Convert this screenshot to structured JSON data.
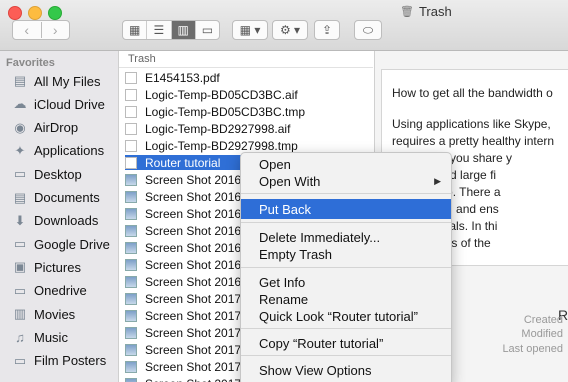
{
  "window": {
    "title": "Trash"
  },
  "toolbar": {
    "back": "‹",
    "forward": "›",
    "view_icons": [
      "icon-view-icon",
      "list-view-icon",
      "column-view-icon",
      "cover-flow-icon"
    ],
    "arrange_glyph": "▦ ▾",
    "action_glyph": "⚙ ▾",
    "share_glyph": "⇪",
    "tag_glyph": "⬭"
  },
  "sidebar": {
    "heading": "Favorites",
    "items": [
      {
        "label": "All My Files",
        "glyph": "▤"
      },
      {
        "label": "iCloud Drive",
        "glyph": "☁"
      },
      {
        "label": "AirDrop",
        "glyph": "◉"
      },
      {
        "label": "Applications",
        "glyph": "✦"
      },
      {
        "label": "Desktop",
        "glyph": "▭"
      },
      {
        "label": "Documents",
        "glyph": "▤"
      },
      {
        "label": "Downloads",
        "glyph": "⬇"
      },
      {
        "label": "Google Drive",
        "glyph": "▭"
      },
      {
        "label": "Pictures",
        "glyph": "▣"
      },
      {
        "label": "Onedrive",
        "glyph": "▭"
      },
      {
        "label": "Movies",
        "glyph": "▥"
      },
      {
        "label": "Music",
        "glyph": "♫"
      },
      {
        "label": "Film Posters",
        "glyph": "▭"
      }
    ]
  },
  "filelist": {
    "heading": "Trash",
    "rows": [
      {
        "name": "E1454153.pdf",
        "kind": "doc"
      },
      {
        "name": "Logic-Temp-BD05CD3BC.aif",
        "kind": "doc"
      },
      {
        "name": "Logic-Temp-BD05CD3BC.tmp",
        "kind": "doc"
      },
      {
        "name": "Logic-Temp-BD2927998.aif",
        "kind": "doc"
      },
      {
        "name": "Logic-Temp-BD2927998.tmp",
        "kind": "doc"
      },
      {
        "name": "Router tutorial",
        "kind": "doc",
        "selected": true
      },
      {
        "name": "Screen Shot 2016-",
        "kind": "img"
      },
      {
        "name": "Screen Shot 2016-",
        "kind": "img"
      },
      {
        "name": "Screen Shot 2016-",
        "kind": "img"
      },
      {
        "name": "Screen Shot 2016-",
        "kind": "img"
      },
      {
        "name": "Screen Shot 2016-",
        "kind": "img"
      },
      {
        "name": "Screen Shot 2016-",
        "kind": "img"
      },
      {
        "name": "Screen Shot 2016-",
        "kind": "img"
      },
      {
        "name": "Screen Shot 2017-",
        "kind": "img"
      },
      {
        "name": "Screen Shot 2017-",
        "kind": "img"
      },
      {
        "name": "Screen Shot 2017-",
        "kind": "img"
      },
      {
        "name": "Screen Shot 2017-",
        "kind": "img"
      },
      {
        "name": "Screen Shot 2017-",
        "kind": "img"
      },
      {
        "name": "Screen Shot 2017-",
        "kind": "img"
      }
    ]
  },
  "preview": {
    "lines": [
      "How to get all the bandwidth o",
      "Using applications like Skype,",
      "requires a pretty healthy intern",
      "maintain if you share y",
      "to download large fi",
      "washing up. There a",
      "our though, and ens",
      "ne individuals. In thi",
      "s regardless of the"
    ],
    "big_letter": "R",
    "meta": [
      "Created",
      "Modified",
      "Last opened"
    ]
  },
  "context_menu": {
    "items": [
      {
        "label": "Open"
      },
      {
        "label": "Open With",
        "submenu": true,
        "arrow": "▶"
      },
      {
        "label": "Put Back",
        "highlighted": true
      },
      {
        "label": "Delete Immediately..."
      },
      {
        "label": "Empty Trash"
      },
      {
        "label": "Get Info"
      },
      {
        "label": "Rename"
      },
      {
        "label": "Quick Look “Router tutorial”"
      },
      {
        "label": "Copy “Router tutorial”"
      },
      {
        "label": "Show View Options"
      }
    ]
  },
  "colors": {
    "selection": "#2f6fd6",
    "menu_highlight": "#2e6ed7"
  }
}
